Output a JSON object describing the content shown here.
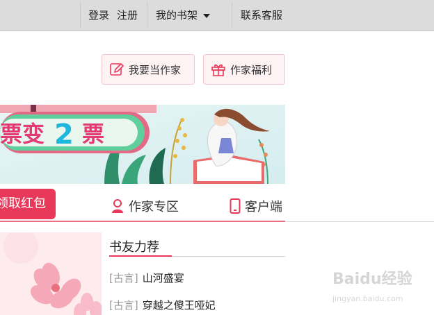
{
  "topbar": {
    "login": "登录",
    "register": "注册",
    "bookshelf": "我的书架",
    "customer_service": "联系客服"
  },
  "buttons": {
    "become_author": "我要当作家",
    "author_benefits": "作家福利"
  },
  "banner": {
    "text_a": "票变",
    "text_b": "2",
    "text_c": "票"
  },
  "nav": {
    "red_packet": "领取红包",
    "author_zone": "作家专区",
    "client": "客户端"
  },
  "section": {
    "title": "书友力荐",
    "items": [
      {
        "tag": "[古言]",
        "title": "山河盛宴"
      },
      {
        "tag": "[古言]",
        "title": "穿越之傻王哑妃"
      }
    ]
  },
  "watermark": {
    "main": "Baidu经验",
    "sub": "jingyan.baidu.com"
  },
  "colors": {
    "accent": "#e8395a",
    "topbar": "#dcdcdc",
    "pill_border": "#f3c4cc"
  }
}
